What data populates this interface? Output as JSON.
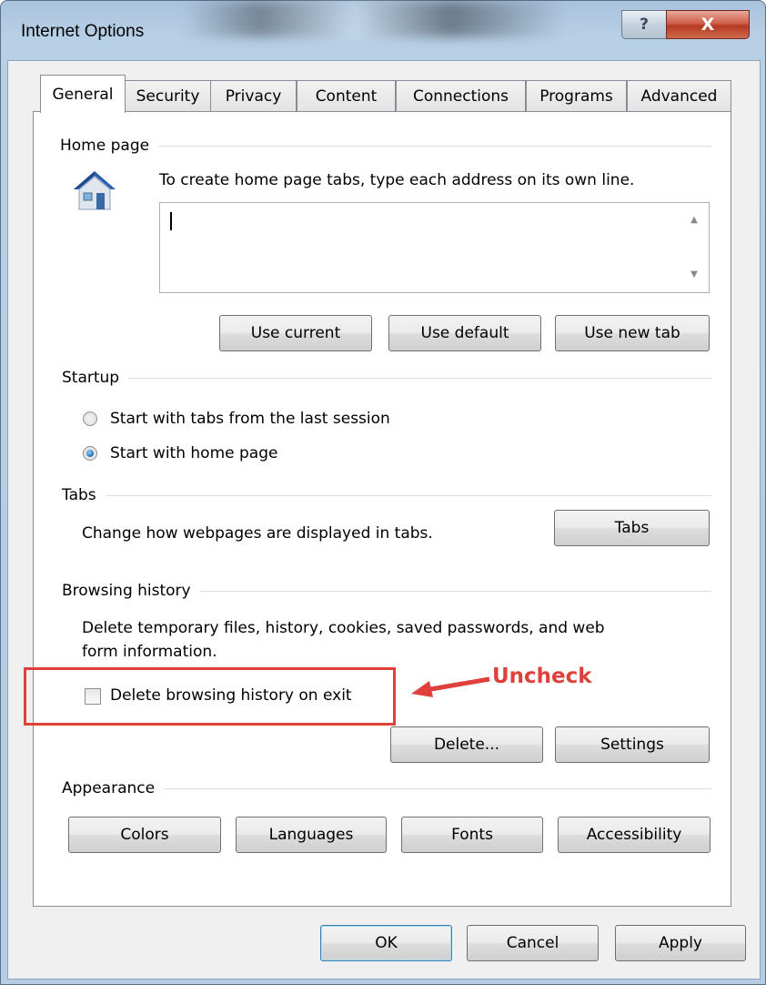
{
  "window": {
    "title": "Internet Options",
    "help_label": "?",
    "close_label": "X"
  },
  "tabs": [
    "General",
    "Security",
    "Privacy",
    "Content",
    "Connections",
    "Programs",
    "Advanced"
  ],
  "home_page": {
    "heading": "Home page",
    "instruction": "To create home page tabs, type each address on its own line.",
    "value": "",
    "buttons": [
      "Use current",
      "Use default",
      "Use new tab"
    ]
  },
  "startup": {
    "heading": "Startup",
    "options": [
      "Start with tabs from the last session",
      "Start with home page"
    ],
    "selected": "Start with home page"
  },
  "tabs_section": {
    "heading": "Tabs",
    "description": "Change how webpages are displayed in tabs.",
    "button": "Tabs"
  },
  "browsing_history": {
    "heading": "Browsing history",
    "description_line1": "Delete temporary files, history, cookies, saved passwords, and web",
    "description_line2": "form information.",
    "checkbox_label": "Delete browsing history on exit",
    "checked": false,
    "buttons": [
      "Delete...",
      "Settings"
    ]
  },
  "annotation": {
    "text": "Uncheck",
    "color": "#e0403a"
  },
  "appearance": {
    "heading": "Appearance",
    "buttons": [
      "Colors",
      "Languages",
      "Fonts",
      "Accessibility"
    ]
  },
  "footer": {
    "ok": "OK",
    "cancel": "Cancel",
    "apply": "Apply"
  }
}
